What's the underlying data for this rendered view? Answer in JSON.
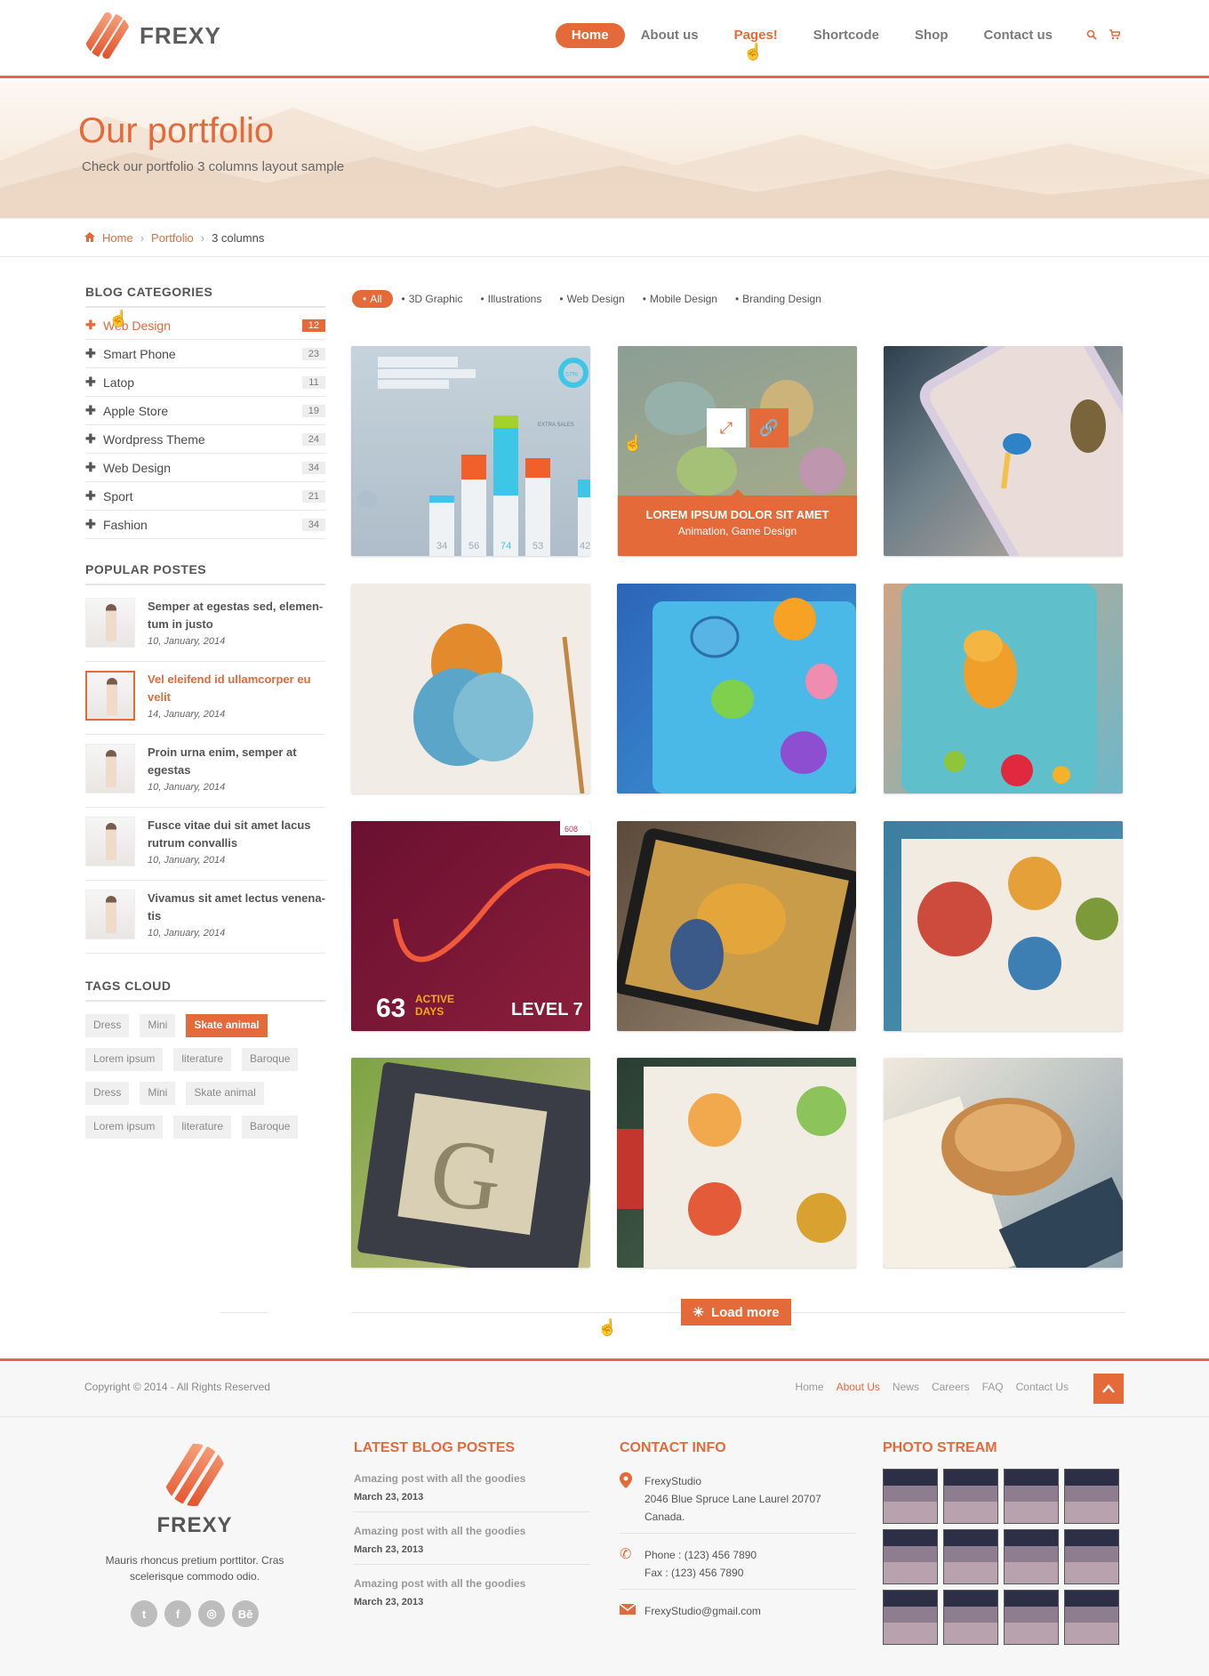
{
  "brand": {
    "name": "FREXY"
  },
  "nav": {
    "items": [
      "Home",
      "About us",
      "Pages!",
      "Shortcode",
      "Shop",
      "Contact us"
    ],
    "search_icon": "search-icon",
    "cart_icon": "cart-icon"
  },
  "hero": {
    "title": "Our portfolio",
    "subtitle": "Check our portfolio 3 columns layout sample"
  },
  "breadcrumb": {
    "home": "Home",
    "portfolio": "Portfolio",
    "current": "3 columns"
  },
  "sidebar": {
    "categories_title": "BLOG CATEGORIES",
    "categories": [
      {
        "label": "Web Design",
        "count": "12"
      },
      {
        "label": "Smart Phone",
        "count": "23"
      },
      {
        "label": "Latop",
        "count": "11"
      },
      {
        "label": "Apple Store",
        "count": "19"
      },
      {
        "label": "Wordpress Theme",
        "count": "24"
      },
      {
        "label": "Web Design",
        "count": "34"
      },
      {
        "label": "Sport",
        "count": "21"
      },
      {
        "label": "Fashion",
        "count": "34"
      }
    ],
    "popular_title": "POPULAR POSTES",
    "posts": [
      {
        "title": "Semper at egestas sed, elemen-tum in justo",
        "date": "10, January, 2014"
      },
      {
        "title": "Vel eleifend id ullamcorper eu velit",
        "date": "14, January, 2014"
      },
      {
        "title": "Proin urna enim, semper at egestas",
        "date": "10, January, 2014"
      },
      {
        "title": "Fusce vitae dui sit amet lacus rutrum convallis",
        "date": "10, January, 2014"
      },
      {
        "title": "Vivamus sit amet lectus venena-tis",
        "date": "10, January, 2014"
      }
    ],
    "tags_title": "TAGS CLOUD",
    "tags": [
      "Dress",
      "Mini",
      "Skate animal",
      "Lorem ipsum",
      "literature",
      "Baroque",
      "Dress",
      "Mini",
      "Skate animal",
      "Lorem ipsum",
      "literature",
      "Baroque"
    ]
  },
  "filters": [
    "All",
    "3D Graphic",
    "Illustrations",
    "Web Design",
    "Mobile Design",
    "Branding Design"
  ],
  "portfolio": {
    "hover_title": "LOREM IPSUM DOLOR SIT AMET",
    "hover_sub": "Animation, Game Design",
    "chart_tile": {
      "labels": [
        "34",
        "56",
        "74",
        "53",
        "42"
      ],
      "badge": "57%",
      "extra": "EXTRA SALES"
    },
    "score_tile": {
      "active": "63",
      "active_label": "ACTIVE",
      "days_label": "DAYS",
      "level": "LEVEL 7",
      "badge": "608"
    }
  },
  "load_more": "Load more",
  "subfooter": {
    "copyright": "Copyright © 2014 - All Rights Reserved",
    "links": [
      "Home",
      "About Us",
      "News",
      "Careers",
      "FAQ",
      "Contact Us"
    ]
  },
  "footer": {
    "brand": "FREXY",
    "desc": "Mauris rhoncus pretium porttitor. Cras scelerisque commodo odio.",
    "blog_title": "LATEST BLOG POSTES",
    "blog_posts": [
      {
        "title": "Amazing post with all the goodies",
        "date": "March 23, 2013"
      },
      {
        "title": "Amazing post with all the goodies",
        "date": "March 23, 2013"
      },
      {
        "title": "Amazing post with all the goodies",
        "date": "March 23, 2013"
      }
    ],
    "contact_title": "CONTACT INFO",
    "contact": {
      "company": "FrexyStudio",
      "address": "2046 Blue Spruce Lane Laurel 20707",
      "country": "Canada.",
      "phone": "Phone : (123) 456 7890",
      "fax": "Fax : (123) 456 7890",
      "email": "FrexyStudio@gmail.com"
    },
    "photo_title": "PHOTO STREAM"
  },
  "colors": {
    "accent": "#e56a3a"
  }
}
